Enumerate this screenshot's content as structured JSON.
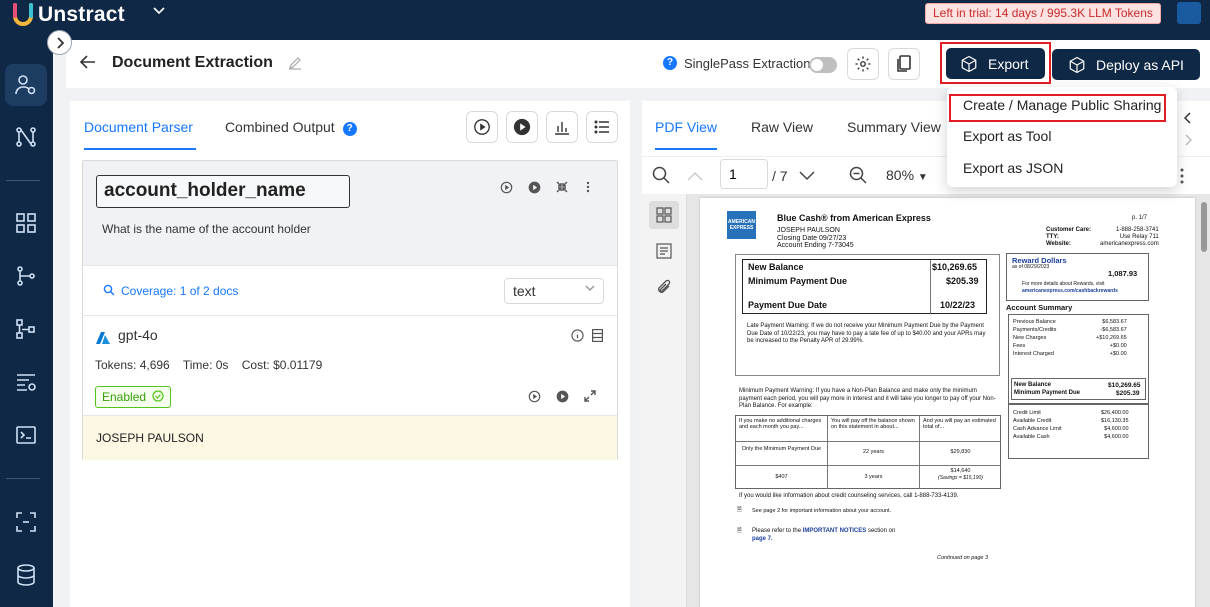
{
  "brand": {
    "name": "Unstract"
  },
  "trial_banner": "Left in trial: 14 days / 995.3K LLM Tokens",
  "header": {
    "title": "Document Extraction",
    "singlepass_label": "SinglePass Extraction",
    "export_label": "Export",
    "deploy_label": "Deploy as API"
  },
  "export_menu": [
    "Create / Manage Public Sharing",
    "Export as Tool",
    "Export as JSON"
  ],
  "left_panel": {
    "tabs": [
      "Document Parser",
      "Combined Output"
    ],
    "prompt": {
      "key": "account_holder_name",
      "text": "What is the name of the account holder",
      "coverage": "Coverage: 1 of 2 docs",
      "output_type": "text"
    },
    "llm": {
      "name": "gpt-4o",
      "tokens": "Tokens: 4,696",
      "time": "Time: 0s",
      "cost": "Cost: $0.01179",
      "status": "Enabled",
      "result": "JOSEPH PAULSON"
    }
  },
  "right_panel": {
    "tabs": [
      "PDF View",
      "Raw View",
      "Summary View"
    ],
    "page": "1",
    "page_total": "/ 7",
    "zoom": "80%"
  },
  "statement": {
    "card": "Blue Cash® from American Express",
    "page_no": "p. 1/7",
    "holder": "JOSEPH PAULSON",
    "closing": "Closing Date 09/27/23",
    "account": "Account Ending 7-73045",
    "cs_labels": "Customer Care:\nTTY:\nWebsite:",
    "cs_values": "1-888-258-3741\nUse Relay 711\namericanexpress.com",
    "new_balance_label": "New Balance",
    "new_balance": "$10,269.65",
    "min_due_label": "Minimum Payment Due",
    "min_due": "$205.39",
    "due_date_label": "Payment Due Date",
    "due_date": "10/22/23",
    "late_warning": "Late Payment Warning: If we do not receive your Minimum Payment Due by the Payment Due Date of 10/22/23, you may have to pay a late fee of up to $40.00 and your APRs may be increased to the Penalty APR of 29.99%.",
    "min_warning": "Minimum Payment Warning: If you have a Non-Plan Balance and make only the minimum payment each period, you will pay more in interest and it will take you longer to pay off your Non-Plan Balance. For example:",
    "tbl_h1": "If you make no additional charges and each month you pay...",
    "tbl_h2": "You will pay off the balance shown on this statement in about...",
    "tbl_h3": "And you will pay an estimated total of...",
    "tbl_r1c1": "Only the Minimum Payment Due",
    "tbl_r1c2": "22 years",
    "tbl_r1c3": "$29,830",
    "tbl_r2c1": "$407",
    "tbl_r2c2": "3 years",
    "tbl_r2c3": "$14,640",
    "tbl_r2c3b": "(Savings = $15,190)",
    "counseling": "If you would like information about credit counseling services, call 1-888-733-4139.",
    "see_page2": "See page 2 for important information about your account.",
    "notices_pre": "Please refer to the",
    "notices_link": "IMPORTANT NOTICES",
    "notices_post": "section on",
    "notices_page": "page 7.",
    "continued": "Continued on page 3",
    "rewards_title": "Reward Dollars",
    "rewards_asof": "as of 08/29/2023",
    "rewards_value": "1,087.93",
    "rewards_info": "For more details about Rewards, visit",
    "rewards_link": "americanexpress.com/cashbackrewards",
    "summary_title": "Account Summary",
    "sum_labels": "Previous Balance\nPayments/Credits\nNew Charges\nFees\nInterest Charged",
    "sum_values": "$6,583.67\n-$6,583.67\n+$10,269.65\n+$0.00\n+$0.00",
    "sum_nb_label": "New Balance",
    "sum_nb": "$10,269.65",
    "sum_mp_label": "Minimum Payment Due",
    "sum_mp": "$205.39",
    "credit_labels": "Credit Limit\nAvailable Credit\nCash Advance Limit\nAvailable Cash",
    "credit_values": "$26,400.00\n$16,130.35\n$4,600.00\n$4,600.00"
  },
  "colors": {
    "navy": "#0e2845",
    "accent": "#1677ff",
    "highlight": "#e31b23"
  }
}
